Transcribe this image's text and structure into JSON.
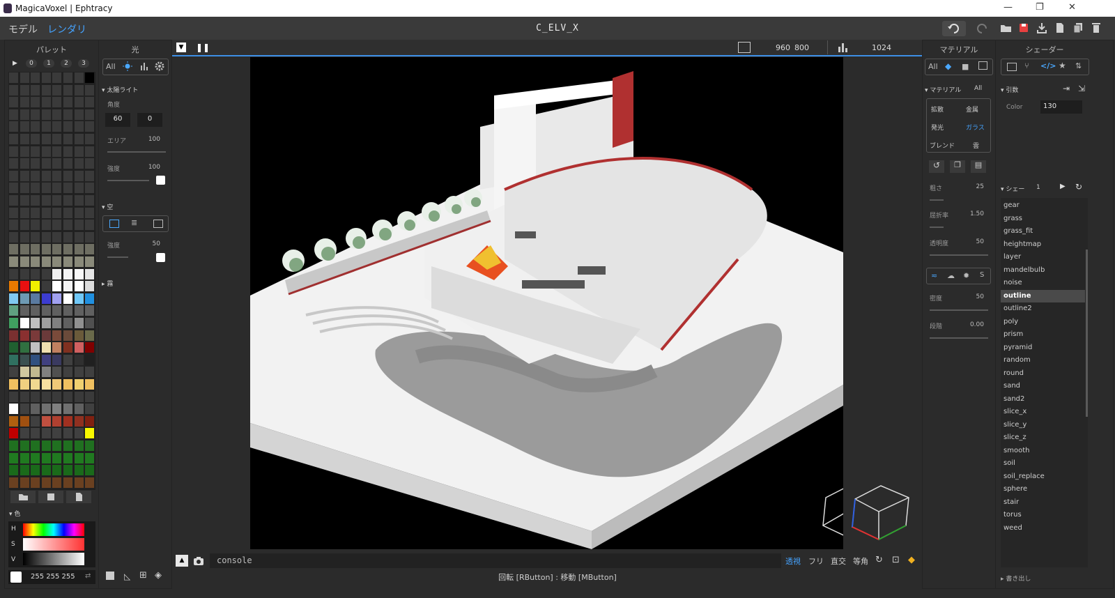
{
  "window": {
    "title": "MagicaVoxel | Ephtracy",
    "minimize": "—",
    "restore": "❐",
    "close": "✕"
  },
  "menu": {
    "tab_model": "モデル",
    "tab_render": "レンダリ",
    "file_name": "C_ELV_X"
  },
  "palette": {
    "header": "パレット",
    "pages": [
      "0",
      "1",
      "2",
      "3"
    ],
    "rows": [
      [
        "#3a3a3a",
        "#3a3a3a",
        "#3a3a3a",
        "#3a3a3a",
        "#3a3a3a",
        "#3a3a3a",
        "#3a3a3a",
        "#000000"
      ],
      [
        "#3a3a3a",
        "#3a3a3a",
        "#3a3a3a",
        "#3a3a3a",
        "#3a3a3a",
        "#3a3a3a",
        "#3a3a3a",
        "#3a3a3a"
      ],
      [
        "#3a3a3a",
        "#3a3a3a",
        "#3a3a3a",
        "#3a3a3a",
        "#3a3a3a",
        "#3a3a3a",
        "#3a3a3a",
        "#3a3a3a"
      ],
      [
        "#3a3a3a",
        "#3a3a3a",
        "#3a3a3a",
        "#3a3a3a",
        "#3a3a3a",
        "#3a3a3a",
        "#3a3a3a",
        "#3a3a3a"
      ],
      [
        "#3a3a3a",
        "#3a3a3a",
        "#3a3a3a",
        "#3a3a3a",
        "#3a3a3a",
        "#3a3a3a",
        "#3a3a3a",
        "#3a3a3a"
      ],
      [
        "#3a3a3a",
        "#3a3a3a",
        "#3a3a3a",
        "#3a3a3a",
        "#3a3a3a",
        "#3a3a3a",
        "#3a3a3a",
        "#3a3a3a"
      ],
      [
        "#3a3a3a",
        "#3a3a3a",
        "#3a3a3a",
        "#3a3a3a",
        "#3a3a3a",
        "#3a3a3a",
        "#3a3a3a",
        "#3a3a3a"
      ],
      [
        "#3a3a3a",
        "#3a3a3a",
        "#3a3a3a",
        "#3a3a3a",
        "#3a3a3a",
        "#3a3a3a",
        "#3a3a3a",
        "#3a3a3a"
      ],
      [
        "#3a3a3a",
        "#3a3a3a",
        "#3a3a3a",
        "#3a3a3a",
        "#3a3a3a",
        "#3a3a3a",
        "#3a3a3a",
        "#3a3a3a"
      ],
      [
        "#3a3a3a",
        "#3a3a3a",
        "#3a3a3a",
        "#3a3a3a",
        "#3a3a3a",
        "#3a3a3a",
        "#3a3a3a",
        "#3a3a3a"
      ],
      [
        "#3a3a3a",
        "#3a3a3a",
        "#3a3a3a",
        "#3a3a3a",
        "#3a3a3a",
        "#3a3a3a",
        "#3a3a3a",
        "#3a3a3a"
      ],
      [
        "#3a3a3a",
        "#3a3a3a",
        "#3a3a3a",
        "#3a3a3a",
        "#3a3a3a",
        "#3a3a3a",
        "#3a3a3a",
        "#3a3a3a"
      ],
      [
        "#3a3a3a",
        "#3a3a3a",
        "#3a3a3a",
        "#3a3a3a",
        "#3a3a3a",
        "#3a3a3a",
        "#3a3a3a",
        "#3a3a3a"
      ],
      [
        "#3a3a3a",
        "#3a3a3a",
        "#3a3a3a",
        "#3a3a3a",
        "#3a3a3a",
        "#3a3a3a",
        "#3a3a3a",
        "#3a3a3a"
      ],
      [
        "#6e6e62",
        "#6e6e62",
        "#6e6e62",
        "#6e6e62",
        "#6e6e62",
        "#6e6e62",
        "#6e6e62",
        "#6e6e62"
      ],
      [
        "#8a8a7a",
        "#8a8a7a",
        "#8a8a7a",
        "#8a8a7a",
        "#8a8a7a",
        "#8a8a7a",
        "#8a8a7a",
        "#8a8a7a"
      ],
      [
        "#3a3a3a",
        "#3a3a3a",
        "#3a3a3a",
        "#3a3a3a",
        "#f0f0f0",
        "#f4f4f4",
        "#f8f8f8",
        "#e6e6e6"
      ],
      [
        "#e87a00",
        "#e81010",
        "#f0f000",
        "#3a3a3a",
        "#ffffff",
        "#f4f4f4",
        "#ffffff",
        "#dcdcdc"
      ],
      [
        "#80c8f0",
        "#6e9ab4",
        "#5a7aa0",
        "#3c3cd0",
        "#a0a0f0",
        "#ffffff",
        "#70c8f8",
        "#2090e0"
      ],
      [
        "#60a080",
        "#606060",
        "#606060",
        "#606060",
        "#606060",
        "#606060",
        "#606060",
        "#606060"
      ],
      [
        "#40a060",
        "#ffffff",
        "#c0c0c0",
        "#a0a0a0",
        "#808080",
        "#606060",
        "#909090",
        "#505050"
      ],
      [
        "#7a3030",
        "#8a3030",
        "#7a3a3a",
        "#6a3a3a",
        "#7a4a3a",
        "#6a4a3a",
        "#6a5a3a",
        "#6a6a4a"
      ],
      [
        "#206030",
        "#307040",
        "#c0c0c0",
        "#f0e0b0",
        "#c08060",
        "#803020",
        "#d06060",
        "#800000"
      ],
      [
        "#307060",
        "#3a5050",
        "#305080",
        "#404080",
        "#3a3a60",
        "#404040",
        "#303030",
        "#202020"
      ],
      [
        "#404040",
        "#d0c8a0",
        "#c0b890",
        "#808080",
        "#505050",
        "#404040",
        "#404040",
        "#404040"
      ],
      [
        "#f0c060",
        "#f0d080",
        "#f0d890",
        "#f8e0a0",
        "#f0c878",
        "#f0c060",
        "#f0d070",
        "#f0c060"
      ],
      [
        "#3a3a3a",
        "#3a3a3a",
        "#3a3a3a",
        "#3a3a3a",
        "#3a3a3a",
        "#3a3a3a",
        "#3a3a3a",
        "#3a3a3a"
      ],
      [
        "#ffffff",
        "#404040",
        "#606060",
        "#707070",
        "#808080",
        "#707070",
        "#606060",
        "#404040"
      ],
      [
        "#b06010",
        "#a05010",
        "#404040",
        "#c05040",
        "#b04030",
        "#a03020",
        "#903020",
        "#802010"
      ],
      [
        "#c00000",
        "#404040",
        "#404040",
        "#404040",
        "#404040",
        "#404040",
        "#404040",
        "#f8f800"
      ],
      [
        "#207020",
        "#207020",
        "#207020",
        "#207020",
        "#207020",
        "#207020",
        "#207020",
        "#207020"
      ],
      [
        "#207a20",
        "#207a20",
        "#207a20",
        "#207a20",
        "#207a20",
        "#207a20",
        "#207a20",
        "#207a20"
      ],
      [
        "#1a6a1a",
        "#1a6a1a",
        "#1a6a1a",
        "#1a6a1a",
        "#1a6a1a",
        "#1a6a1a",
        "#1a6a1a",
        "#1a6a1a"
      ],
      [
        "#6a4020",
        "#6a4020",
        "#6a4020",
        "#6a4020",
        "#6a4020",
        "#6a4020",
        "#6a4020",
        "#6a4020"
      ]
    ],
    "color_section": "色",
    "hsv_labels": [
      "H",
      "S",
      "V"
    ],
    "rgb": "255  255  255"
  },
  "light": {
    "header": "光",
    "filter_all": "All",
    "sun_section": "太陽ライト",
    "angle_label": "角度",
    "angle_values": [
      "60",
      "0"
    ],
    "area_label": "エリア",
    "area_value": "100",
    "intensity_label": "強度",
    "intensity_value": "100",
    "sky_section": "空",
    "sky_intensity_label": "強度",
    "sky_intensity_value": "50",
    "fog_section": "霧"
  },
  "viewport": {
    "width": "960",
    "height": "800",
    "samples": "1024"
  },
  "console": {
    "placeholder": "console"
  },
  "view_modes": {
    "persp": "透視",
    "free": "フリ",
    "ortho": "直交",
    "iso": "等角"
  },
  "status": "回転 [RButton] : 移動 [MButton]",
  "material": {
    "header": "マテリアル",
    "filter_all": "All",
    "section": "マテリアル",
    "section_all": "All",
    "types": [
      "拡散",
      "金属",
      "発光",
      "ガラス",
      "ブレンド",
      "雲"
    ],
    "selected_type": "ガラス",
    "roughness_label": "粗さ",
    "roughness_value": "25",
    "ior_label": "屈折率",
    "ior_value": "1.50",
    "transparency_label": "透明度",
    "transparency_value": "50",
    "density_label": "密度",
    "density_value": "50",
    "phase_label": "段階",
    "phase_value": "0.00",
    "mode_s": "S"
  },
  "shader": {
    "header": "シェーダー",
    "args_section": "引数",
    "color_label": "Color",
    "color_value": "130",
    "list_section": "シェー",
    "list_count": "1",
    "items": [
      "gear",
      "grass",
      "grass_fit",
      "heightmap",
      "layer",
      "mandelbulb",
      "noise",
      "outline",
      "outline2",
      "poly",
      "prism",
      "pyramid",
      "random",
      "round",
      "sand",
      "sand2",
      "slice_x",
      "slice_y",
      "slice_z",
      "smooth",
      "soil",
      "soil_replace",
      "sphere",
      "stair",
      "torus",
      "weed"
    ],
    "selected": "outline",
    "export_label": "書き出し"
  }
}
